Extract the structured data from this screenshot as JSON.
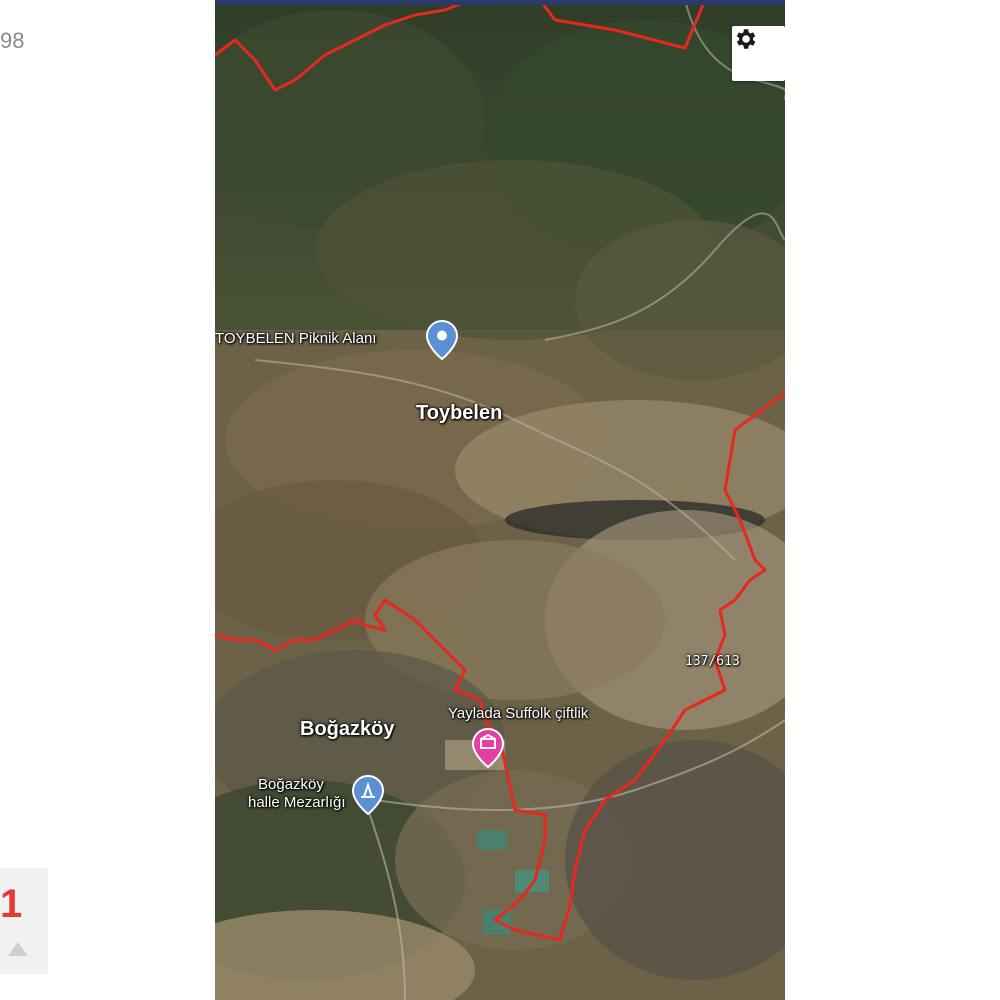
{
  "side": {
    "partial_text": "98",
    "thumb_mark": "1"
  },
  "map": {
    "view": "satellite",
    "boundary_color": "#e8281e",
    "places": {
      "picnic": {
        "label": "TOYBELEN Piknik Alanı",
        "icon": "map-pin-icon"
      },
      "town": {
        "label": "Toybelen"
      },
      "farm": {
        "label": "Yaylada Suffolk çiftlik",
        "icon": "farm-pin-icon"
      },
      "village": {
        "label": "Boğazköy"
      },
      "cemetery": {
        "label_line1": "Boğazköy",
        "label_line2": "halle Mezarlığı",
        "icon": "cemetery-pin-icon"
      }
    },
    "parcel_label": "137/613",
    "controls": {
      "settings_icon": "gear-icon"
    }
  }
}
